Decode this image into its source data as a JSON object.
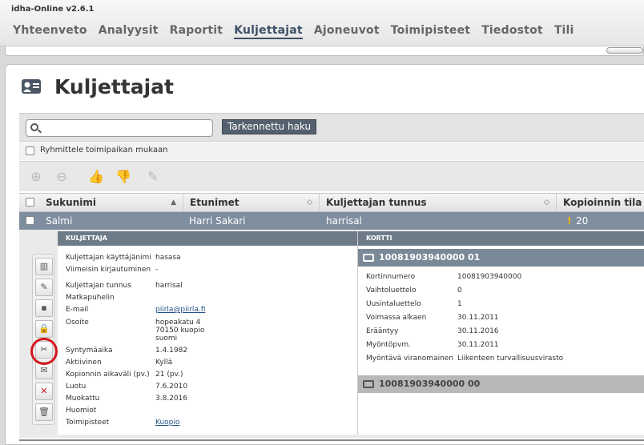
{
  "app": {
    "title": "idha-Online v2.6.1"
  },
  "nav": [
    "Yhteenveto",
    "Analyysit",
    "Raportit",
    "Kuljettajat",
    "Ajoneuvot",
    "Toimipisteet",
    "Tiedostot",
    "Tili"
  ],
  "page": {
    "title": "Kuljettajat"
  },
  "search": {
    "placeholder": "",
    "advanced_label": "Tarkennettu haku",
    "group_label": "Ryhmittele toimipaikan mukaan"
  },
  "table": {
    "columns": [
      "Sukunimi",
      "Etunimet",
      "Kuljettajan tunnus",
      "Kopioinnin tila"
    ],
    "row": {
      "sukunimi": "Salmi",
      "etunimet": "Harri Sakari",
      "tunnus": "harrisal",
      "kopiointi": "20"
    }
  },
  "driver": {
    "header": "KULJETTAJA",
    "fields": [
      {
        "label": "Kuljettajan käyttäjänimi",
        "value": "hasasa"
      },
      {
        "label": "Viimeisin kirjautuminen",
        "value": "-"
      },
      {
        "label": "Kuljettajan tunnus",
        "value": "harrisal"
      },
      {
        "label": "Matkapuhelin",
        "value": ""
      },
      {
        "label": "E-mail",
        "value": "piirla@piirla.fi"
      },
      {
        "label": "Osoite",
        "value": "hopeakatu 4"
      },
      {
        "label": "Syntymäaika",
        "value": "1.4.1982"
      },
      {
        "label": "Aktiivinen",
        "value": "Kyllä"
      },
      {
        "label": "Kopionnin aikaväli (pv.)",
        "value": "21 (pv.)"
      },
      {
        "label": "Luotu",
        "value": "7.6.2010"
      },
      {
        "label": "Muokattu",
        "value": "3.8.2016"
      },
      {
        "label": "Huomiot",
        "value": ""
      },
      {
        "label": "Toimipisteet",
        "value": "Kuopio"
      }
    ],
    "address_line2": "70150  kuopio",
    "address_line3": "suomi"
  },
  "card": {
    "header": "KORTTI",
    "title1": "10081903940000 01",
    "title2": "10081903940000 00",
    "fields": [
      {
        "label": "Kortinnumero",
        "value": "10081903940000"
      },
      {
        "label": "Vaihtoluettelo",
        "value": "0"
      },
      {
        "label": "Uusintaluettelo",
        "value": "1"
      },
      {
        "label": "Voimassa alkaen",
        "value": "30.11.2011"
      },
      {
        "label": "Erääntyy",
        "value": "30.11.2016"
      },
      {
        "label": "Myöntöpvm.",
        "value": "30.11.2011"
      },
      {
        "label": "Myöntävä viranomainen",
        "value": "Liikenteen turvallisuusvirasto"
      }
    ]
  },
  "colors": {
    "accent": "#3c5166",
    "row_selected": "#7e8e9e",
    "highlight": "#d4171d"
  }
}
